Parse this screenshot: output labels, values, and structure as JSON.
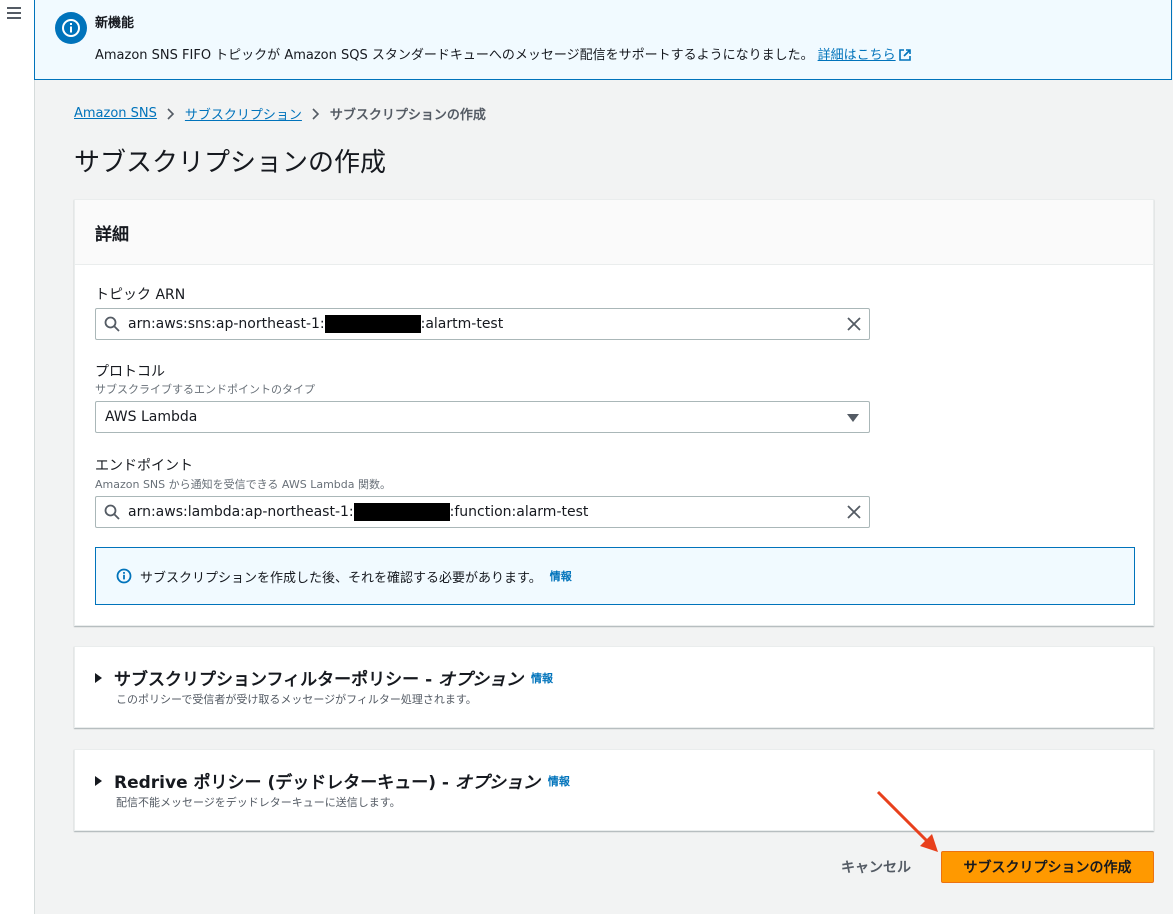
{
  "flash": {
    "title": "新機能",
    "message": "Amazon SNS FIFO トピックが Amazon SQS スタンダードキューへのメッセージ配信をサポートするようになりました。",
    "link": "詳細はこちら"
  },
  "breadcrumb": {
    "items": [
      "Amazon SNS",
      "サブスクリプション"
    ],
    "current": "サブスクリプションの作成"
  },
  "page_title": "サブスクリプションの作成",
  "details": {
    "header": "詳細",
    "topic_arn": {
      "label": "トピック ARN",
      "value_prefix": "arn:aws:sns:ap-northeast-1:",
      "value_suffix": ":alartm-test"
    },
    "protocol": {
      "label": "プロトコル",
      "description": "サブスクライブするエンドポイントのタイプ",
      "value": "AWS Lambda"
    },
    "endpoint": {
      "label": "エンドポイント",
      "description": "Amazon SNS から通知を受信できる AWS Lambda 関数。",
      "value_prefix": "arn:aws:lambda:ap-northeast-1:",
      "value_suffix": ":function:alarm-test"
    },
    "info_message": "サブスクリプションを作成した後、それを確認する必要があります。",
    "info_link": "情報"
  },
  "filter_policy": {
    "title": "サブスクリプションフィルターポリシー - ",
    "title_optional": "オプション",
    "info": "情報",
    "description": "このポリシーで受信者が受け取るメッセージがフィルター処理されます。"
  },
  "redrive_policy": {
    "title": "Redrive ポリシー (デッドレターキュー) - ",
    "title_optional": "オプション",
    "info": "情報",
    "description": "配信不能メッセージをデッドレターキューに送信します。"
  },
  "actions": {
    "cancel": "キャンセル",
    "create": "サブスクリプションの作成"
  },
  "colors": {
    "primary": "#ff9900",
    "link": "#0073bb",
    "annotation_arrow": "#e8401c"
  }
}
